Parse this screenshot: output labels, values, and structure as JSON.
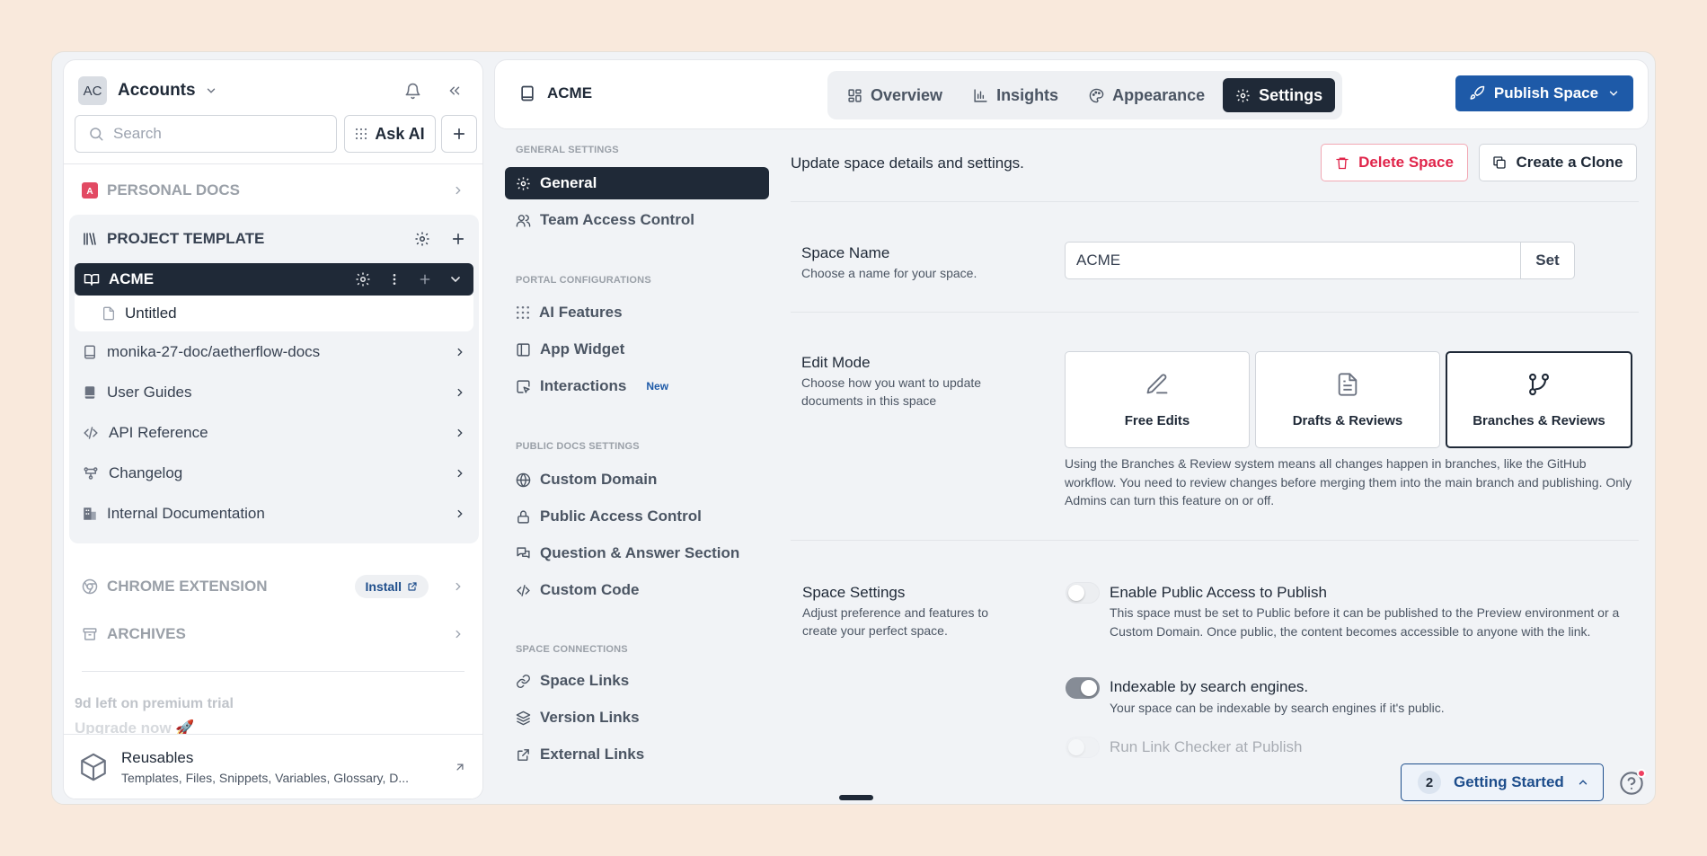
{
  "sidebar": {
    "avatar_initials": "AC",
    "account_name": "Accounts",
    "search_placeholder": "Search",
    "ask_ai_label": "Ask AI",
    "sections": {
      "personal_docs": "PERSONAL DOCS",
      "project_template": "PROJECT TEMPLATE",
      "chrome_extension": "CHROME EXTENSION",
      "archives": "ARCHIVES"
    },
    "install_label": "Install",
    "active_space": "ACME",
    "active_child": "Untitled",
    "tree_items": [
      {
        "label": "monika-27-doc/aetherflow-docs",
        "icon": "book-icon"
      },
      {
        "label": "User Guides",
        "icon": "book-filled-icon"
      },
      {
        "label": "API Reference",
        "icon": "code-icon"
      },
      {
        "label": "Changelog",
        "icon": "git-icon"
      },
      {
        "label": "Internal Documentation",
        "icon": "building-icon"
      }
    ],
    "trial_text": "9d left on premium trial",
    "upgrade_text": "Upgrade now 🚀",
    "reusables": {
      "title": "Reusables",
      "subtitle": "Templates, Files, Snippets, Variables, Glossary, D..."
    }
  },
  "topbar": {
    "space_title": "ACME",
    "tabs": [
      {
        "label": "Overview",
        "icon": "grid-icon"
      },
      {
        "label": "Insights",
        "icon": "chart-icon"
      },
      {
        "label": "Appearance",
        "icon": "palette-icon"
      },
      {
        "label": "Settings",
        "icon": "gear-icon",
        "active": true
      }
    ],
    "publish_label": "Publish Space"
  },
  "settings_nav": {
    "groups": [
      {
        "heading": "GENERAL SETTINGS",
        "items": [
          "General",
          "Team Access Control"
        ]
      },
      {
        "heading": "PORTAL CONFIGURATIONS",
        "items": [
          "AI Features",
          "App Widget",
          "Interactions"
        ]
      },
      {
        "heading": "PUBLIC DOCS SETTINGS",
        "items": [
          "Custom Domain",
          "Public Access Control",
          "Question & Answer Section",
          "Custom Code"
        ]
      },
      {
        "heading": "SPACE CONNECTIONS",
        "items": [
          "Space Links",
          "Version Links",
          "External Links"
        ]
      }
    ],
    "new_badge": "New"
  },
  "content": {
    "description": "Update space details and settings.",
    "delete_label": "Delete Space",
    "clone_label": "Create a Clone",
    "space_name": {
      "title": "Space Name",
      "subtitle": "Choose a name for your space.",
      "value": "ACME",
      "set_label": "Set"
    },
    "edit_mode": {
      "title": "Edit Mode",
      "subtitle": "Choose how you want to update documents in this space",
      "options": [
        "Free Edits",
        "Drafts & Reviews",
        "Branches & Reviews"
      ],
      "selected": "Branches & Reviews",
      "help": "Using the Branches & Review system means all changes happen in branches, like the GitHub workflow. You need to review changes before merging them into the main branch and publishing. Only Admins can turn this feature on or off."
    },
    "space_settings": {
      "title": "Space Settings",
      "subtitle": "Adjust preference and features to create your perfect space.",
      "options": [
        {
          "title": "Enable Public Access to Publish",
          "desc": "This space must be set to Public before it can be published to the Preview environment or a Custom Domain. Once public, the content becomes accessible to anyone with the link.",
          "enabled": false
        },
        {
          "title": "Indexable by search engines.",
          "desc": "Your space can be indexable by search engines if it's public.",
          "enabled": true
        },
        {
          "title": "Run Link Checker at Publish",
          "desc": "",
          "enabled": false
        }
      ]
    }
  },
  "getting_started": {
    "count": "2",
    "label": "Getting Started"
  },
  "colors": {
    "accent": "#1e5aa8",
    "dark": "#1f2937",
    "danger": "#e0244a",
    "page_bg": "#f9e9dc"
  }
}
